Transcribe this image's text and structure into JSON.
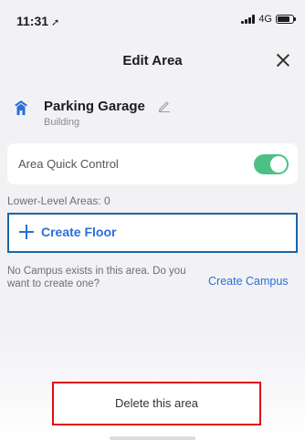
{
  "status_bar": {
    "time": "11:31",
    "location_icon": "location-arrow-icon",
    "network": "4G"
  },
  "nav": {
    "title": "Edit Area",
    "close_icon": "close-icon"
  },
  "area": {
    "name": "Parking Garage",
    "type": "Building",
    "icon": "building-icon",
    "accent_color": "#2a6fd6"
  },
  "quick_control": {
    "label": "Area Quick Control",
    "enabled": true,
    "toggle_color": "#4cc183"
  },
  "lower_levels": "Lower-Level Areas: 0",
  "create_floor": {
    "label": "Create Floor"
  },
  "campus": {
    "message": "No Campus exists in this area. Do you want to create one?",
    "link": "Create Campus"
  },
  "delete": {
    "label": "Delete this area"
  },
  "highlight_colors": {
    "create_floor_border": "#1a64a8",
    "delete_border": "#e01010"
  }
}
